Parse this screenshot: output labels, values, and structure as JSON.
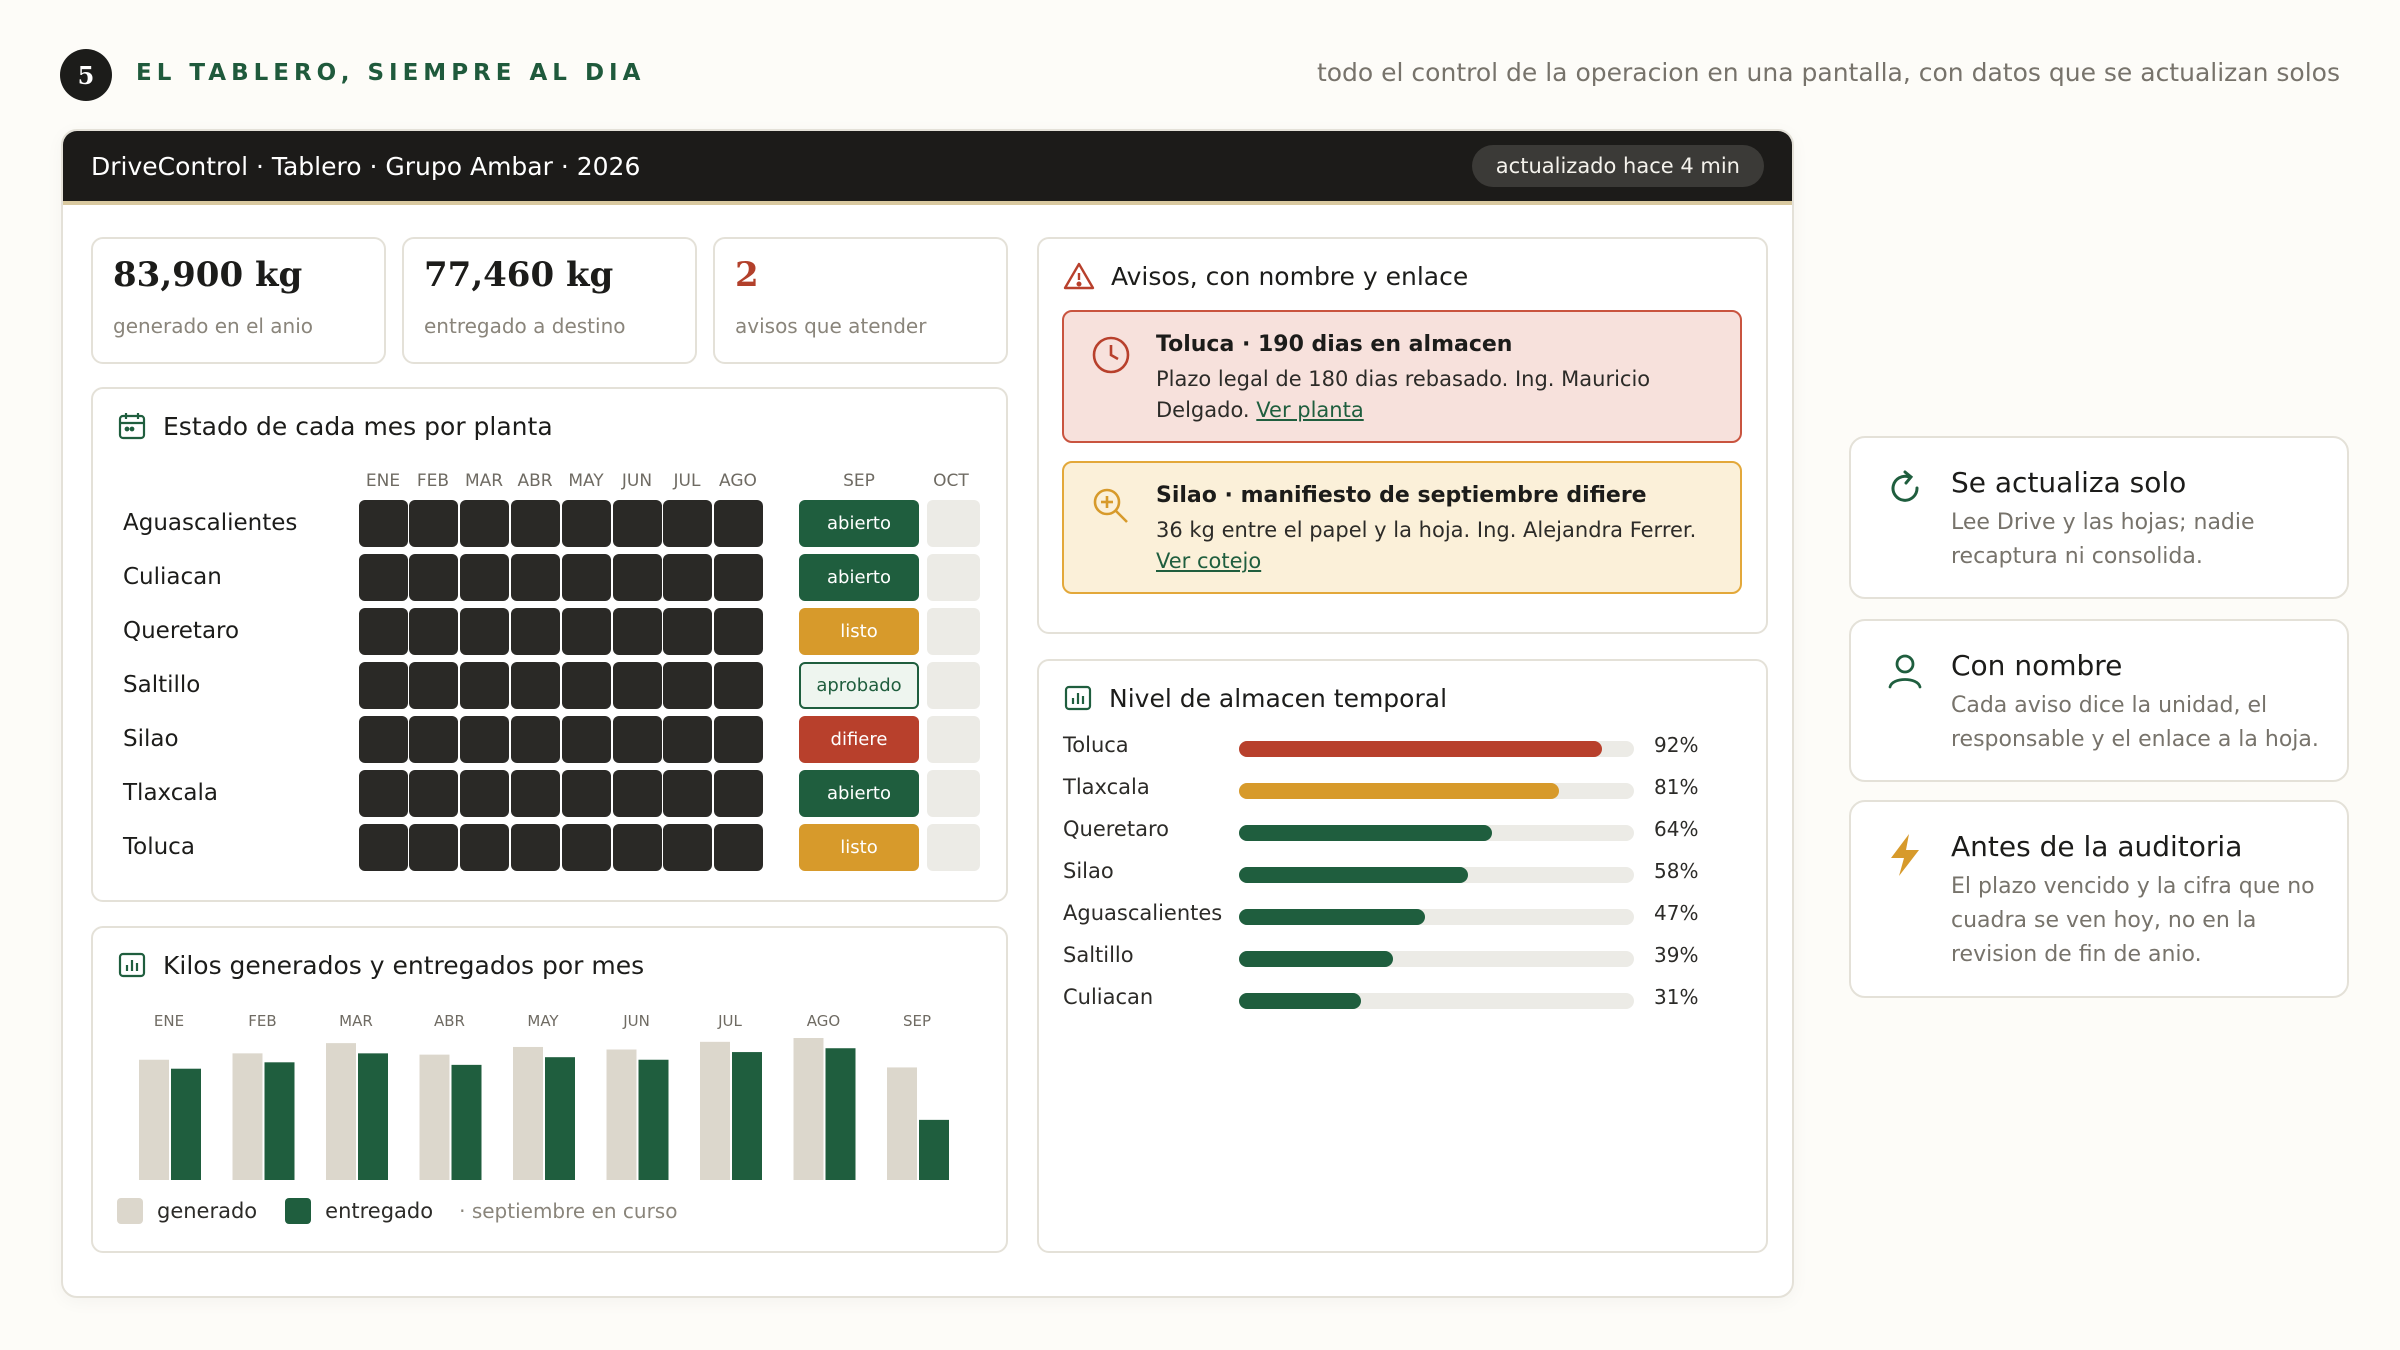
{
  "step": {
    "number": "5",
    "title": "EL TABLERO, SIEMPRE AL DIA",
    "subtitle": "todo el control de la operacion en una pantalla, con datos que se actualizan solos"
  },
  "window": {
    "title": "DriveControl · Tablero · Grupo Ambar · 2026",
    "updated": "actualizado hace 4 min"
  },
  "kpis": [
    {
      "value": "83,900 kg",
      "label": "generado en el anio"
    },
    {
      "value": "77,460 kg",
      "label": "entregado a destino"
    },
    {
      "value": "2",
      "label": "avisos que atender"
    }
  ],
  "months_panel": {
    "title": "Estado de cada mes por planta",
    "months": [
      "ENE",
      "FEB",
      "MAR",
      "ABR",
      "MAY",
      "JUN",
      "JUL",
      "AGO",
      "SEP",
      "OCT"
    ],
    "rows": [
      {
        "plant": "Aguascalientes",
        "status": "abierto"
      },
      {
        "plant": "Culiacan",
        "status": "abierto"
      },
      {
        "plant": "Queretaro",
        "status": "listo"
      },
      {
        "plant": "Saltillo",
        "status": "aprobado"
      },
      {
        "plant": "Silao",
        "status": "difiere"
      },
      {
        "plant": "Tlaxcala",
        "status": "abierto"
      },
      {
        "plant": "Toluca",
        "status": "listo"
      }
    ]
  },
  "kilos_panel": {
    "title": "Kilos generados y entregados por mes",
    "legend_generated": "generado",
    "legend_delivered": "entregado",
    "note": "· septiembre en curso"
  },
  "chart_data": {
    "type": "bar",
    "categories": [
      "ENE",
      "FEB",
      "MAR",
      "ABR",
      "MAY",
      "JUN",
      "JUL",
      "AGO",
      "SEP"
    ],
    "series": [
      {
        "name": "generado",
        "values": [
          9400,
          9900,
          10700,
          9800,
          10400,
          10200,
          10800,
          11100,
          8800
        ]
      },
      {
        "name": "entregado",
        "values": [
          8700,
          9200,
          9900,
          9000,
          9600,
          9400,
          10000,
          10300,
          4700
        ]
      }
    ],
    "legend": "bottom-left",
    "grid": false,
    "colors": {
      "generado": "#dcd7cc",
      "entregado": "#1f5e3e"
    }
  },
  "alerts_panel": {
    "title": "Avisos, con nombre y enlace",
    "alerts": [
      {
        "title": "Toluca · 190 dias en almacen",
        "body": "Plazo legal de 180 dias rebasado. Ing. Mauricio Delgado.",
        "link": "Ver planta"
      },
      {
        "title": "Silao · manifiesto de septiembre difiere",
        "body": "36 kg entre el papel y la hoja. Ing. Alejandra Ferrer.",
        "link": "Ver cotejo"
      }
    ]
  },
  "storage_panel": {
    "title": "Nivel de almacen temporal",
    "rows": [
      {
        "plant": "Toluca",
        "pct": 92,
        "pct_label": "92%",
        "color": "#b8402c"
      },
      {
        "plant": "Tlaxcala",
        "pct": 81,
        "pct_label": "81%",
        "color": "#d79a2b"
      },
      {
        "plant": "Queretaro",
        "pct": 64,
        "pct_label": "64%",
        "color": "#1f5e3e"
      },
      {
        "plant": "Silao",
        "pct": 58,
        "pct_label": "58%",
        "color": "#1f5e3e"
      },
      {
        "plant": "Aguascalientes",
        "pct": 47,
        "pct_label": "47%",
        "color": "#1f5e3e"
      },
      {
        "plant": "Saltillo",
        "pct": 39,
        "pct_label": "39%",
        "color": "#1f5e3e"
      },
      {
        "plant": "Culiacan",
        "pct": 31,
        "pct_label": "31%",
        "color": "#1f5e3e"
      }
    ]
  },
  "features": [
    {
      "icon": "refresh-icon",
      "title": "Se actualiza solo",
      "body": "Lee Drive y las hojas; nadie recaptura ni consolida."
    },
    {
      "icon": "user-icon",
      "title": "Con nombre",
      "body": "Cada aviso dice la unidad, el responsable y el enlace a la hoja."
    },
    {
      "icon": "lightning-icon",
      "title": "Antes de la auditoria",
      "body": "El plazo vencido y la cifra que no cuadra se ven hoy, no en la revision de fin de anio."
    }
  ],
  "colors": {
    "brand_green": "#1f5e3e",
    "alert_red": "#b8402c",
    "alert_amber": "#d79a2b",
    "dark": "#1c1b19"
  }
}
